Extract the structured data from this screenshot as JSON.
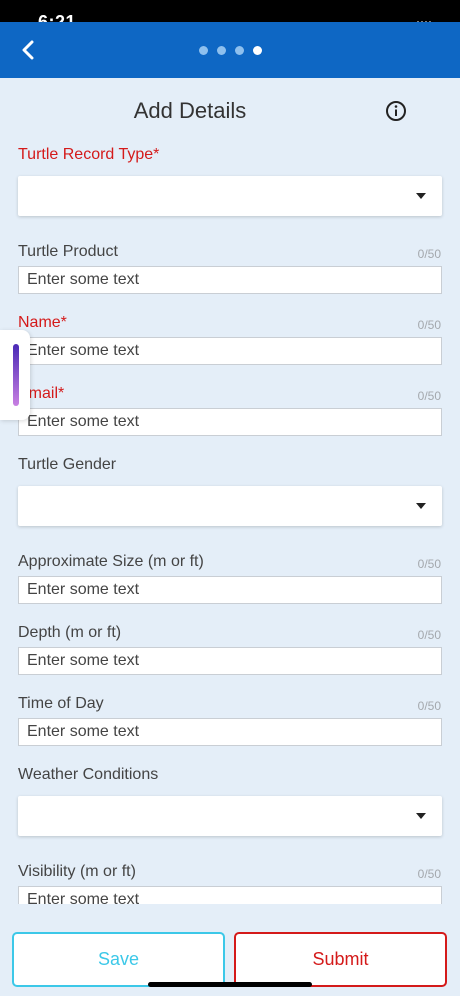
{
  "status_bar": {
    "time": "6:21",
    "signal": "····"
  },
  "nav": {
    "page_count": 4,
    "active_page": 4
  },
  "header": {
    "title": "Add Details"
  },
  "form": {
    "fields": [
      {
        "key": "turtle_record_type",
        "label": "Turtle Record Type*",
        "kind": "dropdown",
        "required": true,
        "value": ""
      },
      {
        "key": "turtle_product",
        "label": "Turtle Product",
        "kind": "text",
        "required": false,
        "placeholder": "Enter some text",
        "counter": "0/50"
      },
      {
        "key": "name",
        "label": "Name*",
        "kind": "text",
        "required": true,
        "placeholder": "Enter some text",
        "counter": "0/50"
      },
      {
        "key": "email",
        "label": "Email*",
        "kind": "text",
        "required": true,
        "placeholder": "Enter some text",
        "counter": "0/50"
      },
      {
        "key": "turtle_gender",
        "label": "Turtle Gender",
        "kind": "dropdown",
        "required": false,
        "value": ""
      },
      {
        "key": "approximate_size",
        "label": "Approximate Size (m or ft)",
        "kind": "text",
        "required": false,
        "placeholder": "Enter some text",
        "counter": "0/50"
      },
      {
        "key": "depth",
        "label": "Depth (m or ft)",
        "kind": "text",
        "required": false,
        "placeholder": "Enter some text",
        "counter": "0/50"
      },
      {
        "key": "time_of_day",
        "label": "Time of Day",
        "kind": "text",
        "required": false,
        "placeholder": "Enter some text",
        "counter": "0/50"
      },
      {
        "key": "weather_conditions",
        "label": "Weather Conditions",
        "kind": "dropdown",
        "required": false,
        "value": ""
      },
      {
        "key": "visibility",
        "label": "Visibility (m or ft)",
        "kind": "text",
        "required": false,
        "placeholder": "Enter some text",
        "counter": "0/50"
      }
    ]
  },
  "actions": {
    "save_label": "Save",
    "submit_label": "Submit"
  },
  "colors": {
    "nav_bar": "#0e67c4",
    "background": "#e4eef8",
    "required_label": "#d41a1a",
    "save_accent": "#3cc8e8",
    "submit_accent": "#d41a1a"
  },
  "icons": {
    "back": "chevron-left-icon",
    "info": "info-circle-icon",
    "dropdown": "caret-down-icon",
    "side_tab": "side-drawer-handle-icon"
  }
}
